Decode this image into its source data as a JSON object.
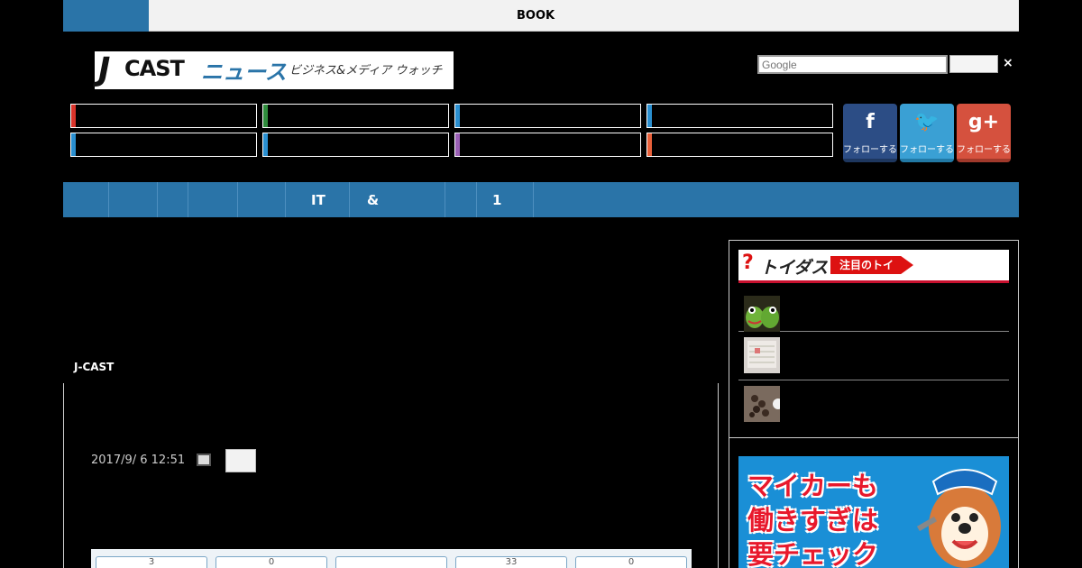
{
  "topbar": {
    "book_label": "BOOK"
  },
  "logo": {
    "j": "J",
    "cast": "CAST",
    "news": "ニュース",
    "tagline": "ビジネス&メディア ウォッチ"
  },
  "search": {
    "placeholder": "Google",
    "close_symbol": "×"
  },
  "categories": [
    {
      "color": "#d9342b"
    },
    {
      "color": "#2f8c3c"
    },
    {
      "color": "#2a8fd0"
    },
    {
      "color": "#2a8fd0"
    },
    {
      "color": "#2a8fd0"
    },
    {
      "color": "#2a8fd0"
    },
    {
      "color": "#9a5fb5"
    },
    {
      "color": "#e8603a"
    }
  ],
  "social": {
    "facebook": {
      "glyph": "f",
      "label": "フォローする",
      "icon": "facebook-icon"
    },
    "twitter": {
      "glyph": "🐦",
      "label": "フォローする",
      "icon": "twitter-icon"
    },
    "googleplus": {
      "glyph": "g+",
      "label": "フォローする",
      "icon": "google-plus-icon"
    }
  },
  "nav": {
    "items": [
      "",
      "",
      "",
      "",
      "",
      "IT",
      "&",
      "",
      "1"
    ]
  },
  "article": {
    "site_name": "J-CAST",
    "date": "2017/9/ 6 12:51",
    "share_counts": [
      "3",
      "0",
      "",
      "33",
      "0"
    ]
  },
  "sidebar": {
    "toi_logo": "トイダス",
    "toi_badge": "注目のトイ"
  },
  "ad": {
    "line1": "マイカーも",
    "line2": "働きすぎは",
    "line3": "要チェック"
  },
  "colors": {
    "accent": "#2a74a8",
    "brand_red": "#d11"
  }
}
